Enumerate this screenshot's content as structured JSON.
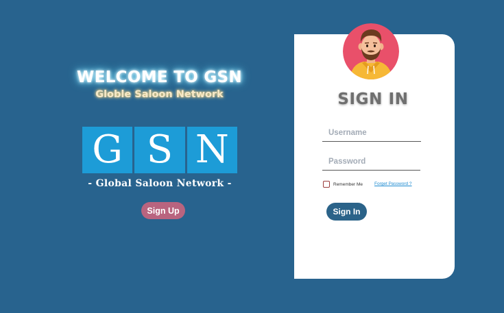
{
  "colors": {
    "background": "#28638e",
    "card": "#ffffff",
    "logo_tile": "#1d9cd7",
    "signup_button": "#b9647f",
    "signin_button": "#2b6389",
    "link": "#1c8ad0"
  },
  "hero": {
    "welcome": "WELCOME TO GSN",
    "subtitle": "Globle Saloon Network"
  },
  "logo": {
    "letters": [
      "G",
      "S",
      "N"
    ],
    "tagline": "- Global Saloon Network -"
  },
  "signup": {
    "label": "Sign Up"
  },
  "login": {
    "avatar_icon": "user-avatar-icon",
    "title": "SIGN IN",
    "username_placeholder": "Username",
    "password_placeholder": "Password",
    "remember_label": "Remember Me",
    "remember_checked": false,
    "forgot_label": "Forget Password ?",
    "submit_label": "Sign In"
  }
}
